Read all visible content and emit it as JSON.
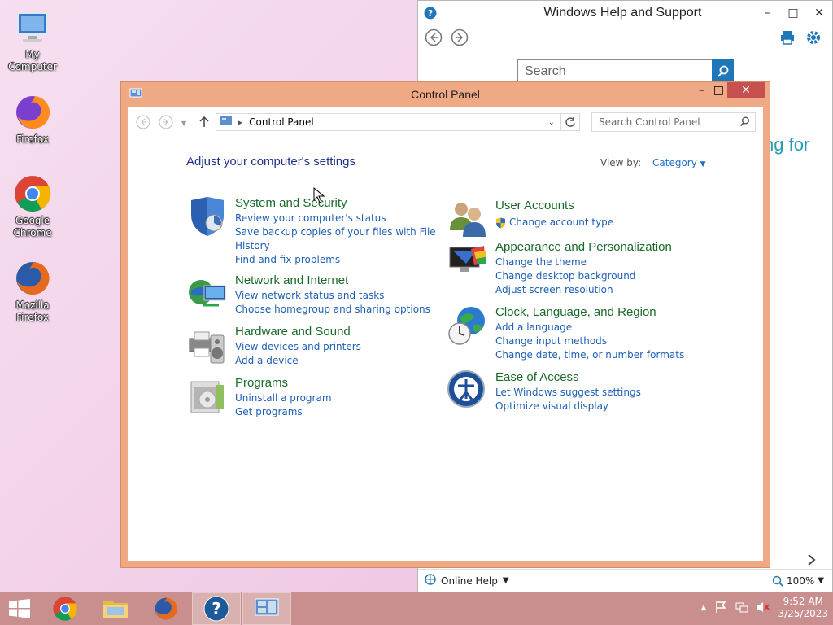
{
  "desktop": {
    "icons": [
      {
        "label": "My Computer"
      },
      {
        "label": "Firefox"
      },
      {
        "label": "Google Chrome"
      },
      {
        "label": "Mozilla Firefox"
      }
    ]
  },
  "help_window": {
    "title": "Windows Help and Support",
    "search_placeholder": "Search",
    "partial_text": "ng for",
    "online_help": "Online Help",
    "zoom": "100%"
  },
  "control_panel": {
    "title": "Control Panel",
    "breadcrumb": "Control Panel",
    "search_placeholder": "Search Control Panel",
    "headline": "Adjust your computer's settings",
    "view_by_label": "View by:",
    "view_by_value": "Category",
    "categories": [
      {
        "title": "System and Security",
        "links": [
          "Review your computer's status",
          "Save backup copies of your files with File",
          "History",
          "Find and fix problems"
        ]
      },
      {
        "title": "Network and Internet",
        "links": [
          "View network status and tasks",
          "Choose homegroup and sharing options"
        ]
      },
      {
        "title": "Hardware and Sound",
        "links": [
          "View devices and printers",
          "Add a device"
        ]
      },
      {
        "title": "Programs",
        "links": [
          "Uninstall a program",
          "Get programs"
        ]
      },
      {
        "title": "User Accounts",
        "links": [
          "Change account type"
        ]
      },
      {
        "title": "Appearance and Personalization",
        "links": [
          "Change the theme",
          "Change desktop background",
          "Adjust screen resolution"
        ]
      },
      {
        "title": "Clock, Language, and Region",
        "links": [
          "Add a language",
          "Change input methods",
          "Change date, time, or number formats"
        ]
      },
      {
        "title": "Ease of Access",
        "links": [
          "Let Windows suggest settings",
          "Optimize visual display"
        ]
      }
    ]
  },
  "taskbar": {
    "time": "9:52 AM",
    "date": "3/25/2023"
  },
  "colors": {
    "cp_frame": "#f0a985",
    "link_blue": "#1f5fb5",
    "category_green": "#1a6b2a",
    "taskbar": "#c98f8f"
  }
}
